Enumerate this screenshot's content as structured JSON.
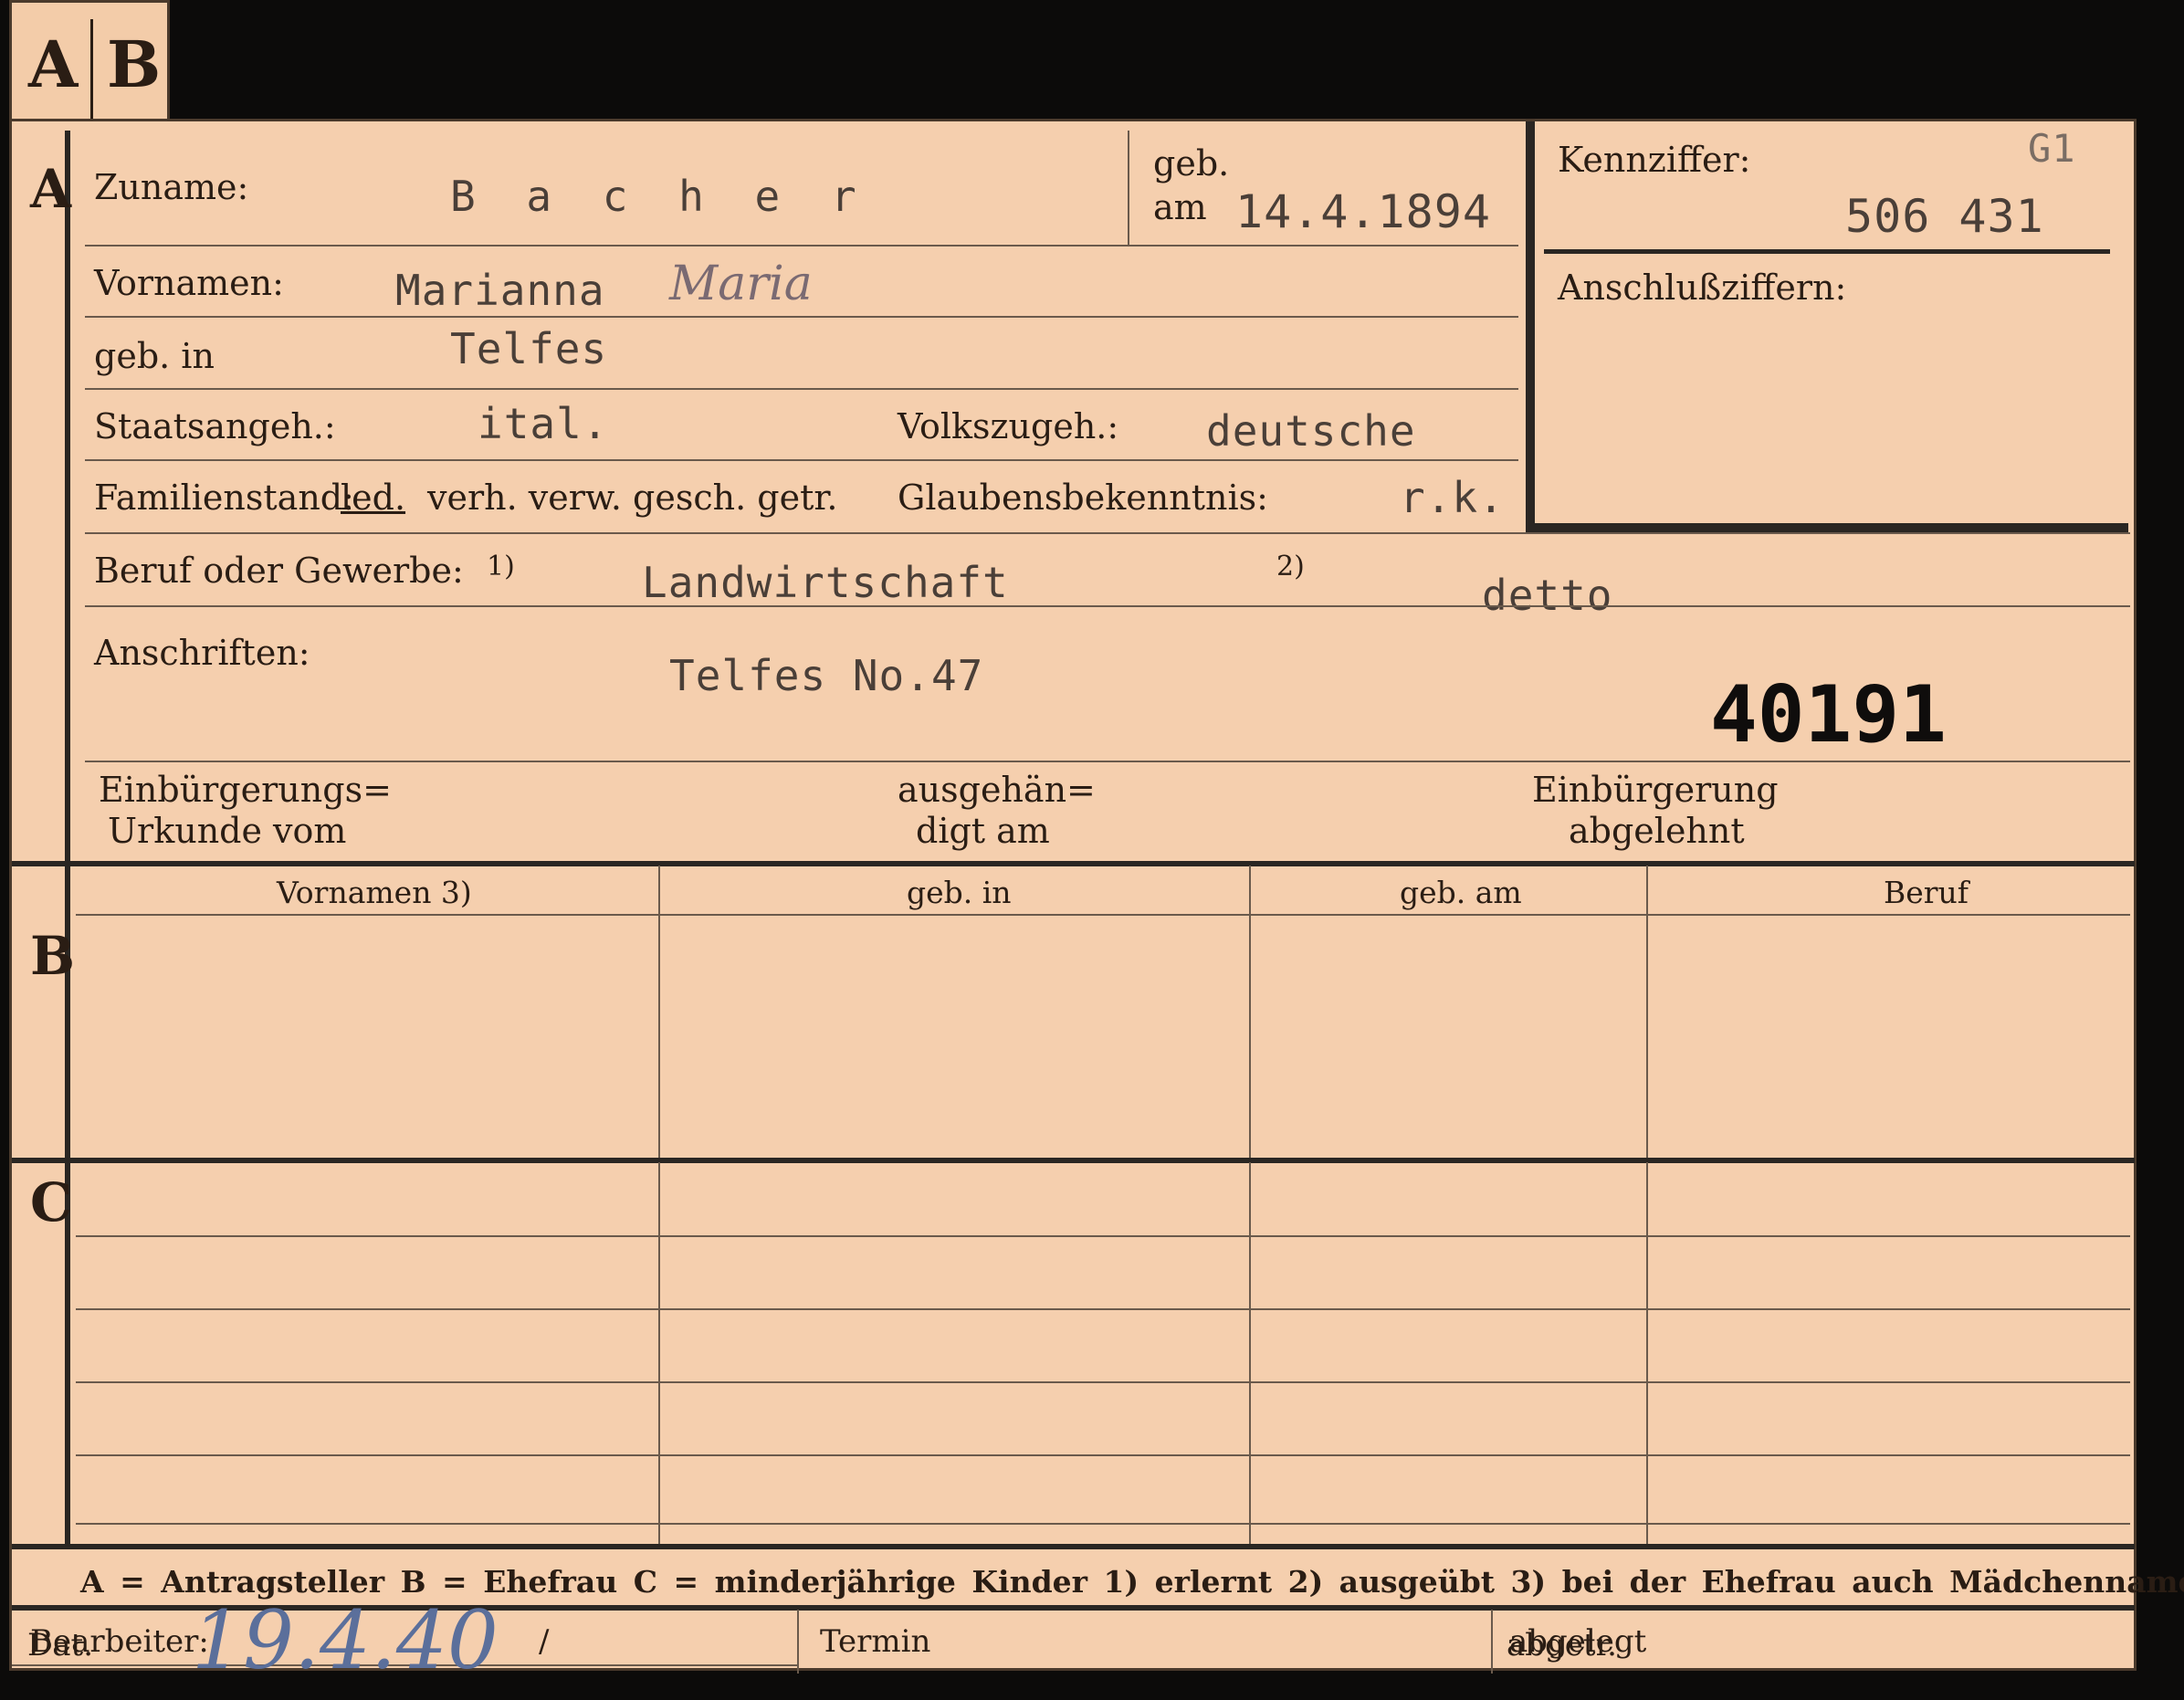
{
  "tab": {
    "letters": [
      "A",
      "B"
    ]
  },
  "section_A": {
    "marker": "A",
    "zuname_label": "Zuname:",
    "zuname_value": "B a c h e r",
    "geb_label": "geb.",
    "am_label": "am",
    "geb_date": "14.4.1894",
    "vornamen_label": "Vornamen:",
    "vornamen_value": "Marianna",
    "vornamen_handwritten": "Maria",
    "gebin_label": "geb. in",
    "gebin_value": "Telfes",
    "staatsangeh_label": "Staatsangeh.:",
    "staatsangeh_value": "ital.",
    "volkszugeh_label": "Volkszugeh.:",
    "volkszugeh_value": "deutsche",
    "familienstand_label": "Familienstand:",
    "familienstand_selected": "led.",
    "familienstand_options": "verh. verw. gesch. getr.",
    "glauben_label": "Glaubensbekenntnis:",
    "glauben_value": "r.k.",
    "beruf_label": "Beruf oder Gewerbe:",
    "beruf_note1": "1)",
    "beruf_value1": "Landwirtschaft",
    "beruf_note2": "2)",
    "beruf_value2": "detto",
    "anschriften_label": "Anschriften:",
    "anschriften_value": "Telfes No.47",
    "stamp_number": "40191",
    "einb_urkunde_l1": "Einbürgerungs=",
    "einb_urkunde_l2": "Urkunde vom",
    "ausgeh_l1": "ausgehän=",
    "ausgeh_l2": "digt am",
    "einb_abgelehnt_l1": "Einbürgerung",
    "einb_abgelehnt_l2": "abgelehnt"
  },
  "kennziffer": {
    "label": "Kennziffer:",
    "code": "G1",
    "number": "506 431",
    "anschluss_label": "Anschlußziffern:"
  },
  "section_B": {
    "marker": "B",
    "columns": [
      "Vornamen 3)",
      "geb. in",
      "geb. am",
      "Beruf"
    ]
  },
  "section_C": {
    "marker": "C"
  },
  "legend": "A = Antragsteller   B = Ehefrau   C = minderjährige Kinder   1) erlernt   2) ausgeübt   3) bei der Ehefrau auch Mädchenname",
  "footer": {
    "bearbeiter_label": "Bearbeiter:",
    "dat_label": "Dat.",
    "dat_value": "19.4.40",
    "dat_slash": "/",
    "termin_label": "Termin",
    "abgelegt_label": "abgelegt",
    "abgetr_label": "abgetr."
  }
}
